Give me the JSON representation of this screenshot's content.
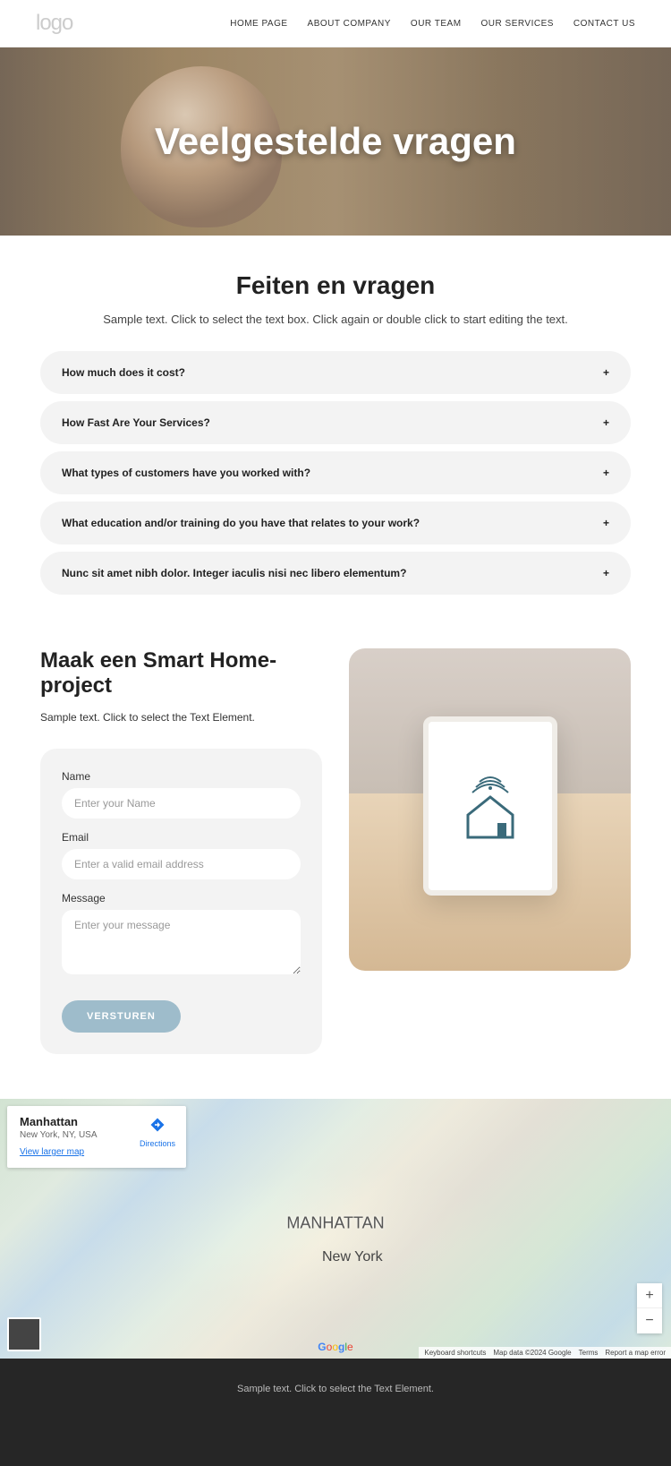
{
  "logo_text": "logo",
  "nav": [
    "HOME PAGE",
    "ABOUT COMPANY",
    "OUR TEAM",
    "OUR SERVICES",
    "CONTACT US"
  ],
  "hero_title": "Veelgestelde vragen",
  "faq": {
    "heading": "Feiten en vragen",
    "subtext": "Sample text. Click to select the text box. Click again or double click to start editing the text.",
    "items": [
      "How much does it cost?",
      "How Fast Are Your Services?",
      "What types of customers have you worked with?",
      "What education and/or training do you have that relates to your work?",
      "Nunc sit amet nibh dolor. Integer iaculis nisi nec libero elementum?"
    ]
  },
  "contact": {
    "heading": "Maak een Smart Home-project",
    "subtext": "Sample text. Click to select the Text Element.",
    "labels": {
      "name": "Name",
      "email": "Email",
      "message": "Message"
    },
    "placeholders": {
      "name": "Enter your Name",
      "email": "Enter a valid email address",
      "message": "Enter your message"
    },
    "submit": "VERSTUREN"
  },
  "map": {
    "card_title": "Manhattan",
    "card_sub": "New York, NY, USA",
    "card_link": "View larger map",
    "directions": "Directions",
    "center_label": "MANHATTAN",
    "city_label": "New York",
    "attrib": [
      "Keyboard shortcuts",
      "Map data ©2024 Google",
      "Terms",
      "Report a map error"
    ]
  },
  "footer_text": "Sample text. Click to select the Text Element."
}
